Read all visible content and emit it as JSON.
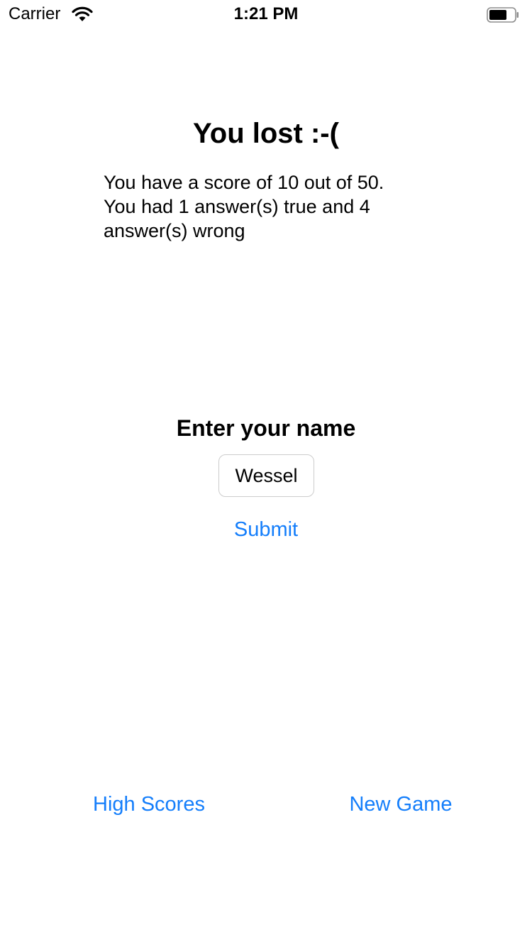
{
  "status_bar": {
    "carrier": "Carrier",
    "time": "1:21 PM",
    "wifi_icon": "wifi-icon",
    "battery_icon": "battery-icon"
  },
  "result": {
    "title": "You lost :-(",
    "message": "You have a score of 10 out of 50.\nYou had 1 answer(s) true and 4\nanswer(s) wrong"
  },
  "name_form": {
    "heading": "Enter your name",
    "name_value": "Wessel",
    "submit_label": "Submit"
  },
  "bottom_actions": {
    "high_scores_label": "High Scores",
    "new_game_label": "New Game"
  },
  "colors": {
    "accent": "#147efb",
    "text": "#000000",
    "background": "#ffffff",
    "input_border": "#cccccc"
  }
}
